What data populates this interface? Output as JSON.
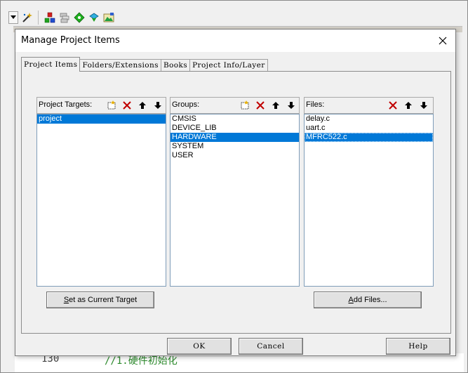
{
  "ide": {
    "line_number": "130",
    "comment_text": "//1.硬件初始化"
  },
  "dialog": {
    "title": "Manage Project Items"
  },
  "tabs": [
    {
      "label": "Project Items",
      "active": true
    },
    {
      "label": "Folders/Extensions",
      "active": false
    },
    {
      "label": "Books",
      "active": false
    },
    {
      "label": "Project Info/Layer",
      "active": false
    }
  ],
  "targets": {
    "title": "Project Targets:",
    "items": [
      "project"
    ],
    "selected": 0
  },
  "groups": {
    "title": "Groups:",
    "items": [
      "CMSIS",
      "DEVICE_LIB",
      "HARDWARE",
      "SYSTEM",
      "USER"
    ],
    "selected": 2
  },
  "files": {
    "title": "Files:",
    "items": [
      "delay.c",
      "uart.c",
      "MFRC522.c"
    ],
    "selected": 2
  },
  "buttons": {
    "set_target_prefix": "S",
    "set_target_rest": "et as Current Target",
    "add_files_prefix": "A",
    "add_files_rest": "dd Files...",
    "ok": "OK",
    "cancel": "Cancel",
    "help": "Help"
  },
  "colors": {
    "selection": "#0078d7",
    "delete_red": "#c00000",
    "comment_green": "#2c8a2c"
  }
}
